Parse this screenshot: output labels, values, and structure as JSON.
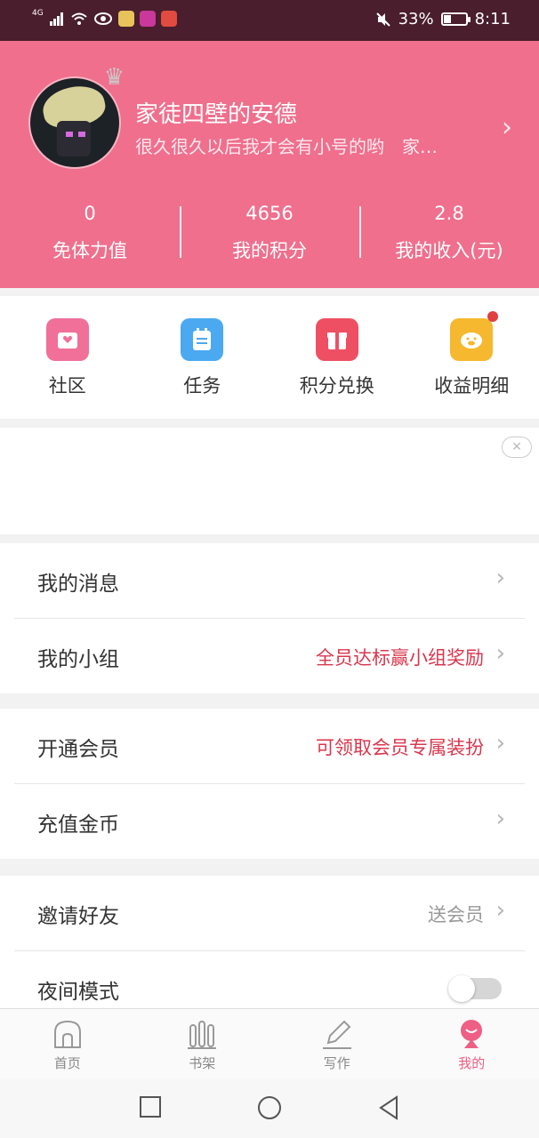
{
  "status_bar": {
    "network": "4G",
    "battery_percent": "33%",
    "battery_level": 0.33,
    "time": "8:11",
    "icons": [
      "signal-icon",
      "wifi-icon",
      "eye-icon",
      "app-icon",
      "video-app-icon",
      "store-app-icon",
      "mute-icon",
      "battery-icon"
    ]
  },
  "profile": {
    "username": "家徒四壁的安德",
    "signature": "很久很久以后我才会有小号的哟　家…"
  },
  "stats": [
    {
      "value": "0",
      "label": "免体力值"
    },
    {
      "value": "4656",
      "label": "我的积分"
    },
    {
      "value": "2.8",
      "label": "我的收入(元)"
    }
  ],
  "quick_actions": [
    {
      "label": "社区",
      "color": "#f0709a",
      "icon": "community-icon"
    },
    {
      "label": "任务",
      "color": "#4aa9f0",
      "icon": "task-icon"
    },
    {
      "label": "积分兑换",
      "color": "#ef4f62",
      "icon": "gift-icon"
    },
    {
      "label": "收益明细",
      "color": "#f5b82e",
      "icon": "piggy-bank-icon"
    }
  ],
  "ad": {
    "close_label": "✕"
  },
  "menu": {
    "my_messages": {
      "label": "我的消息"
    },
    "my_group": {
      "label": "我的小组",
      "hint": "全员达标赢小组奖励"
    },
    "vip": {
      "label": "开通会员",
      "hint": "可领取会员专属装扮"
    },
    "recharge": {
      "label": "充值金币"
    },
    "invite": {
      "label": "邀请好友",
      "hint": "送会员"
    },
    "night_mode": {
      "label": "夜间模式",
      "enabled": false
    }
  },
  "tabs": [
    {
      "label": "首页",
      "icon": "home-icon",
      "active": false
    },
    {
      "label": "书架",
      "icon": "bookshelf-icon",
      "active": false
    },
    {
      "label": "写作",
      "icon": "pen-icon",
      "active": false
    },
    {
      "label": "我的",
      "icon": "profile-icon",
      "active": true
    }
  ],
  "colors": {
    "header": "#ef6f8d",
    "accent": "#ef5f85",
    "hint_red": "#d9374e",
    "status_bar": "#4a1e2c"
  }
}
